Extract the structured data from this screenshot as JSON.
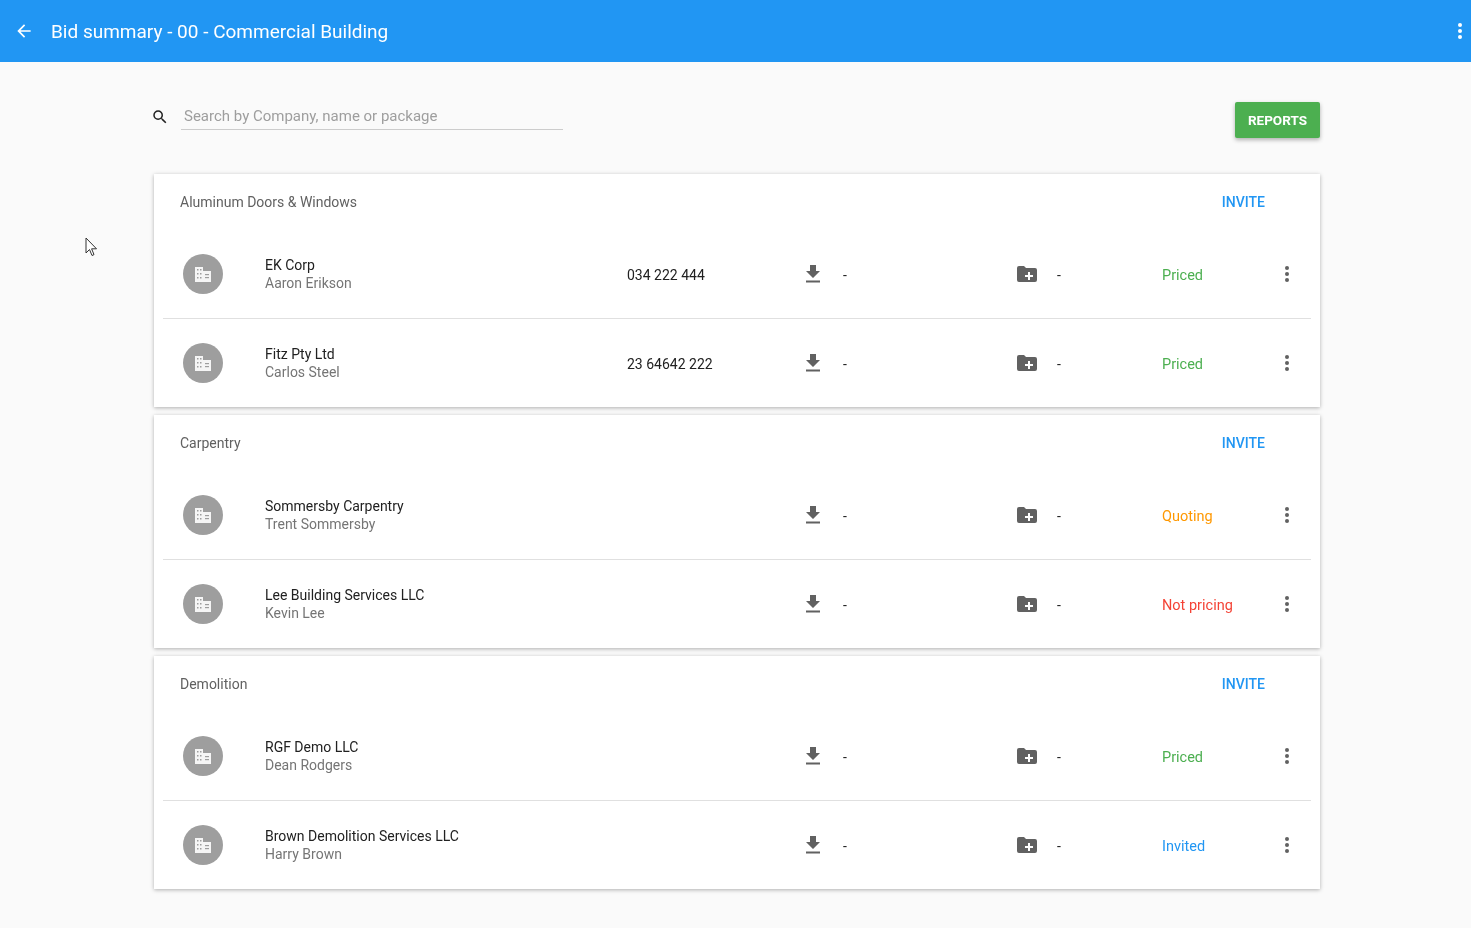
{
  "app_bar": {
    "title": "Bid summary - 00 - Commercial Building"
  },
  "search": {
    "placeholder": "Search by Company, name or package"
  },
  "reports_button": "REPORTS",
  "packages": [
    {
      "name": "Aluminum Doors & Windows",
      "invite": "INVITE",
      "bids": [
        {
          "company": "EK Corp",
          "contact": "Aaron Erikson",
          "phone": "034 222 444",
          "downloads": "-",
          "documents": "-",
          "status": {
            "label": "Priced",
            "color": "#4caf50"
          }
        },
        {
          "company": "Fitz Pty Ltd",
          "contact": "Carlos Steel",
          "phone": "23 64642 222",
          "downloads": "-",
          "documents": "-",
          "status": {
            "label": "Priced",
            "color": "#4caf50"
          }
        }
      ]
    },
    {
      "name": "Carpentry",
      "invite": "INVITE",
      "bids": [
        {
          "company": "Sommersby Carpentry",
          "contact": "Trent Sommersby",
          "downloads": "-",
          "documents": "-",
          "status": {
            "label": "Quoting",
            "color": "#ff9800"
          }
        },
        {
          "company": "Lee Building Services LLC",
          "contact": "Kevin Lee",
          "downloads": "-",
          "documents": "-",
          "status": {
            "label": "Not pricing",
            "color": "#f44336"
          }
        }
      ]
    },
    {
      "name": "Demolition",
      "invite": "INVITE",
      "bids": [
        {
          "company": "RGF Demo LLC",
          "contact": "Dean Rodgers",
          "downloads": "-",
          "documents": "-",
          "status": {
            "label": "Priced",
            "color": "#4caf50"
          }
        },
        {
          "company": "Brown Demolition Services LLC",
          "contact": "Harry Brown",
          "downloads": "-",
          "documents": "-",
          "status": {
            "label": "Invited",
            "color": "#2196f3"
          }
        }
      ]
    }
  ]
}
